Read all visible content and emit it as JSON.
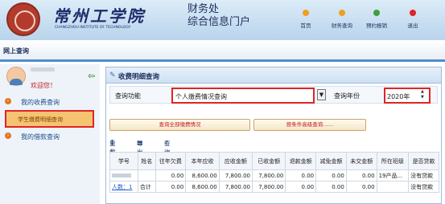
{
  "header": {
    "logo_cn": "常州工学院",
    "logo_en": "CHANGZHOU INSTITUTE OF TECHNOLOGY",
    "portal_line1": "财务处",
    "portal_line2": "综合信息门户",
    "nav": [
      {
        "label": "首页",
        "color": "#f0a020"
      },
      {
        "label": "财务查询",
        "color": "#f0a020"
      },
      {
        "label": "预约报销",
        "color": "#3ca03c"
      },
      {
        "label": "退出",
        "color": "#e02424"
      }
    ]
  },
  "tabbar": {
    "active_tab": "网上查询"
  },
  "sidebar": {
    "welcome": "欢迎您！",
    "sections": [
      {
        "label": "我的收费查询"
      },
      {
        "label": "我的借款查询"
      }
    ],
    "selected_item": "学生缴费明细查询"
  },
  "main": {
    "title": "收费明细查询",
    "query_func_label": "查询功能",
    "query_func_value": "个人缴费情况查询",
    "query_year_label": "查询年份",
    "query_year_value": "2020年",
    "btn_all": "查询全部缴费情况",
    "btn_advanced": "按条件高级查询……",
    "toolbar": {
      "reset": "重载",
      "export": "导出",
      "query": "查询"
    },
    "table": {
      "headers": [
        "学号",
        "姓名",
        "往年欠费",
        "本年应收",
        "应收金额",
        "已收金额",
        "退款金额",
        "减免金额",
        "未交金额",
        "所在班级",
        "是否贷款"
      ],
      "rows": [
        [
          "",
          "",
          "0.00",
          "8,600.00",
          "7,800.00",
          "7,800.00",
          "0.00",
          "0.00",
          "0.00",
          "19产品...",
          "没有贷款"
        ],
        [
          "人数：1",
          "合计",
          "0.00",
          "8,600.00",
          "7,800.00",
          "7,800.00",
          "0.00",
          "0.00",
          "0.00",
          "",
          "没有贷款"
        ]
      ]
    }
  }
}
